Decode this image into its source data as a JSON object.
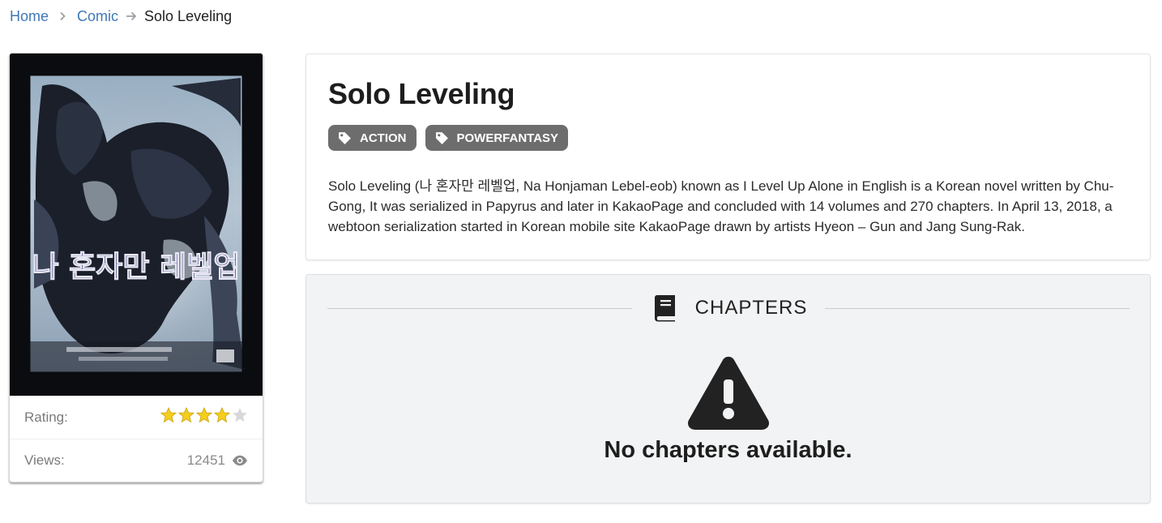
{
  "breadcrumb": {
    "home": "Home",
    "section": "Comic",
    "current": "Solo Leveling"
  },
  "cover": {
    "alt_icon": "manga-cover-image",
    "title_art_text": "나 혼자만 레벨업"
  },
  "stats": {
    "rating_label": "Rating:",
    "rating_value": 4,
    "rating_max": 5,
    "views_label": "Views:",
    "views_value": "12451",
    "views_icon": "eye-icon"
  },
  "comic": {
    "title": "Solo Leveling",
    "tags": [
      "ACTION",
      "POWERFANTASY"
    ],
    "tag_icon": "tag-icon",
    "description": "Solo Leveling (나 혼자만 레벨업, Na Honjaman Lebel-eob) known as I Level Up Alone in English is a Korean novel written by Chu-Gong, It was serialized in Papyrus and later in KakaoPage and concluded with 14 volumes and 270 chapters. In April 13, 2018, a webtoon serialization started in Korean mobile site KakaoPage drawn by artists Hyeon – Gun and Jang Sung-Rak."
  },
  "chapters": {
    "heading": "CHAPTERS",
    "heading_icon": "book-icon",
    "empty_icon": "warning-icon",
    "empty_message": "No chapters available."
  },
  "colors": {
    "link": "#3f78b8",
    "tag_bg": "#6d6d6d",
    "star": "#f5cd1d",
    "star_empty": "#d8d8d8",
    "panel_bg": "#f2f3f4"
  }
}
